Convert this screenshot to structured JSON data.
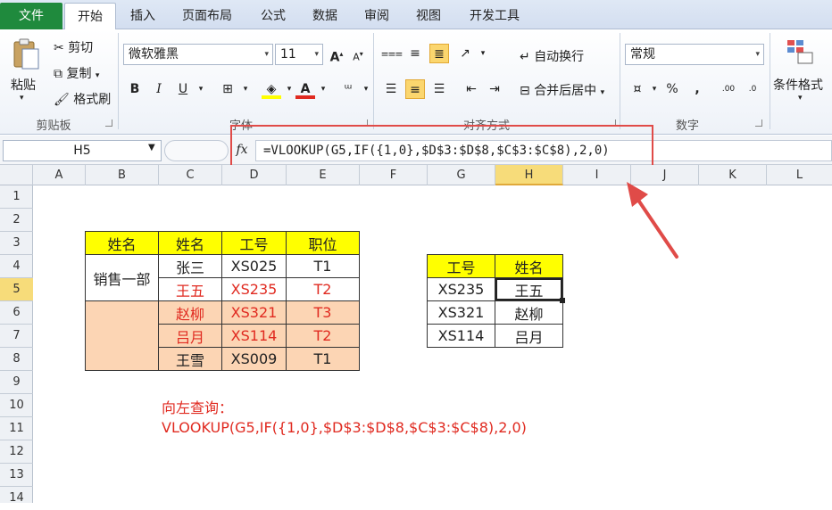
{
  "ribbon_tabs": {
    "file": "文件",
    "items": [
      "开始",
      "插入",
      "页面布局",
      "公式",
      "数据",
      "审阅",
      "视图",
      "开发工具"
    ]
  },
  "clipboard": {
    "paste": "粘贴",
    "cut": "剪切",
    "copy": "复制",
    "format_painter": "格式刷",
    "group": "剪贴板"
  },
  "font": {
    "name": "微软雅黑",
    "size": "11",
    "group": "字体"
  },
  "alignment": {
    "wrap_text": "自动换行",
    "merge_center": "合并后居中",
    "group": "对齐方式"
  },
  "number": {
    "format": "常规",
    "percent": "%",
    "comma": ",",
    "group": "数字"
  },
  "styles": {
    "conditional_format": "条件格式"
  },
  "formula_bar": {
    "name_box": "H5",
    "fx": "fx",
    "formula": "=VLOOKUP(G5,IF({1,0},$D$3:$D$8,$C$3:$C$8),2,0)"
  },
  "columns": [
    "A",
    "B",
    "C",
    "D",
    "E",
    "F",
    "G",
    "H",
    "I",
    "J",
    "K",
    "L"
  ],
  "active_column": "H",
  "rows": [
    "1",
    "2",
    "3",
    "4",
    "5",
    "6",
    "7",
    "8",
    "9",
    "10",
    "11",
    "12",
    "13",
    "14"
  ],
  "active_row": "5",
  "table1": {
    "headers": [
      "姓名",
      "姓名",
      "工号",
      "职位"
    ],
    "dept": "销售一部",
    "rows": [
      {
        "name": "张三",
        "id": "XS025",
        "pos": "T1"
      },
      {
        "name": "王五",
        "id": "XS235",
        "pos": "T2"
      },
      {
        "name": "赵柳",
        "id": "XS321",
        "pos": "T3"
      },
      {
        "name": "吕月",
        "id": "XS114",
        "pos": "T2"
      },
      {
        "name": "王雪",
        "id": "XS009",
        "pos": "T1"
      }
    ]
  },
  "table2": {
    "headers": [
      "工号",
      "姓名"
    ],
    "rows": [
      {
        "id": "XS235",
        "name": "王五"
      },
      {
        "id": "XS321",
        "name": "赵柳"
      },
      {
        "id": "XS114",
        "name": "吕月"
      }
    ]
  },
  "note": {
    "line1": "向左查询：",
    "line2": "VLOOKUP(G5,IF({1,0},$D$3:$D$8,$C$3:$C$8),2,0)"
  },
  "colors": {
    "accent_red": "#e02a20",
    "header_yellow": "#ffff00",
    "fill_orange": "#fcd5b4",
    "file_tab_green": "#1f8a3d"
  }
}
